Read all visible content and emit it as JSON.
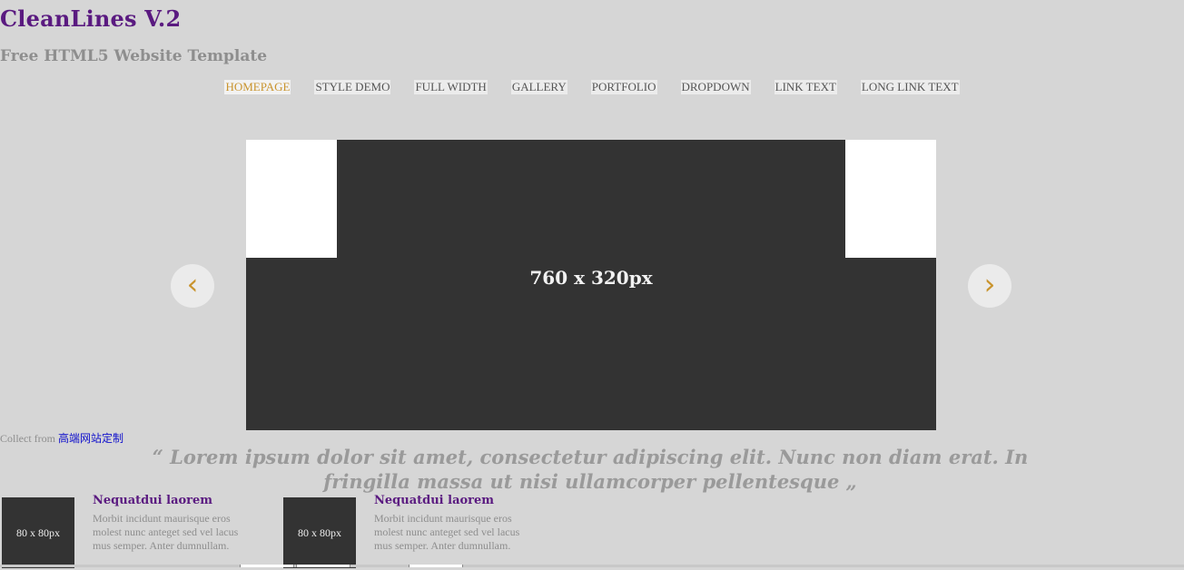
{
  "header": {
    "title": "CleanLines V.2",
    "subtitle": "Free HTML5 Website Template"
  },
  "nav": {
    "items": [
      {
        "label": "HOMEPAGE",
        "active": true
      },
      {
        "label": "STYLE DEMO"
      },
      {
        "label": "FULL WIDTH"
      },
      {
        "label": "GALLERY"
      },
      {
        "label": "PORTFOLIO"
      },
      {
        "label": "DROPDOWN"
      },
      {
        "label": "LINK TEXT"
      },
      {
        "label": "LONG LINK TEXT"
      }
    ]
  },
  "slider": {
    "label": "760 x 320px",
    "prev_icon": "chevron-left-icon",
    "prev_glyph": "‹",
    "next_icon": "chevron-right-icon",
    "next_glyph": "›"
  },
  "collect": {
    "prefix": "Collect from",
    "link": "高端网站定制"
  },
  "quote": {
    "text": "“ Lorem ipsum dolor sit amet, consectetur adipiscing elit. Nunc non diam erat. In fringilla massa ut nisi ullamcorper pellentesque „"
  },
  "features": [
    {
      "thumb": "80 x 80px",
      "title": "Nequatdui laorem",
      "body": "Morbit incidunt maurisque eros molest nunc anteget sed vel lacus mus semper. Anter dumnullam."
    },
    {
      "thumb": "80 x 80px",
      "title": "Nequatdui laorem",
      "body": "Morbit incidunt maurisque eros molest nunc anteget sed vel lacus mus semper. Anter dumnullam."
    }
  ],
  "colors": {
    "background": "#d6d6d6",
    "brand": "#5a1a80",
    "accent": "#c9942e",
    "placeholder": "#333333"
  }
}
